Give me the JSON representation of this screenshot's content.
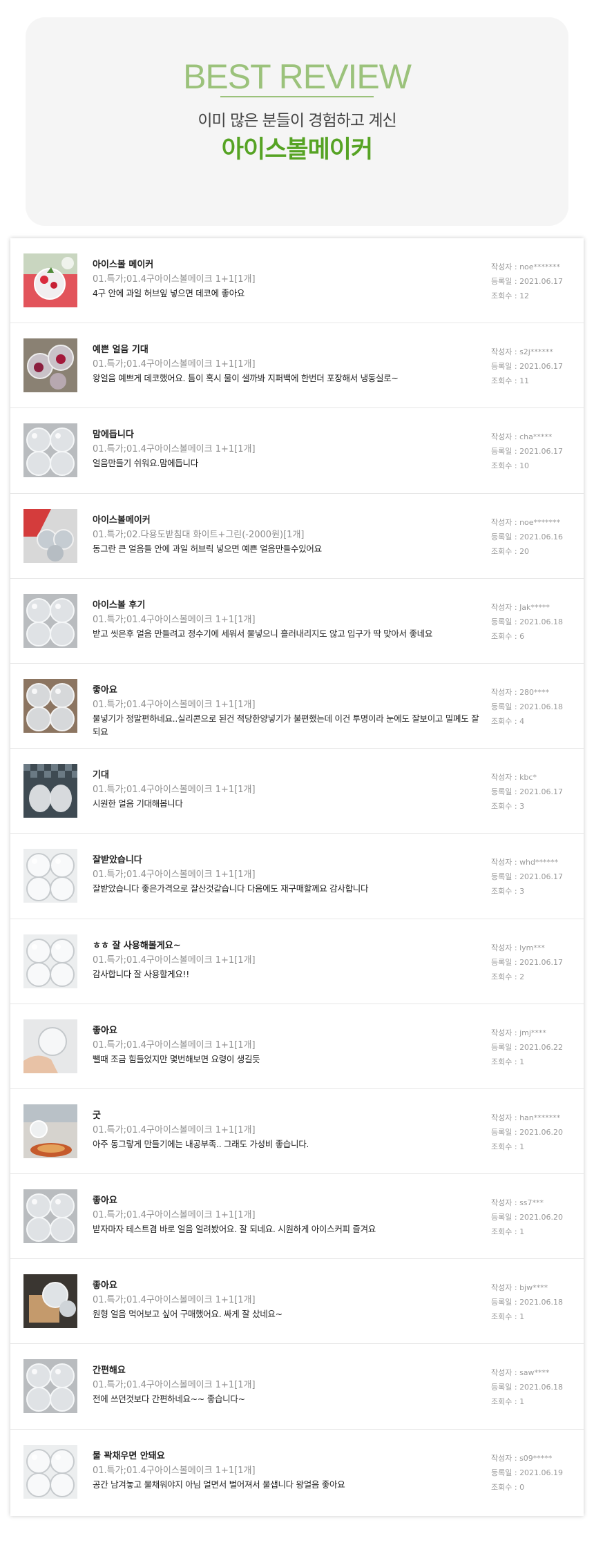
{
  "hero": {
    "title": "BEST REVIEW",
    "subtitle": "이미 많은 분들이 경험하고 계신",
    "product": "아이스볼메이커"
  },
  "labels": {
    "writer": "작성자 : ",
    "date": "등록일 : ",
    "views": "조회수 : "
  },
  "reviews": [
    {
      "title": "아이스볼 메이커",
      "option": "01.특가;01.4구아이스볼메이크 1+1[1개]",
      "text": "4구 안에 과일 허브잎 넣으면 데코에 좋아요",
      "writer": "noe*******",
      "date": "2021.06.17",
      "views": "12",
      "thumb": "strawberry"
    },
    {
      "title": "예쁜 얼음 기대",
      "option": "01.특가;01.4구아이스볼메이크 1+1[1개]",
      "text": "왕얼음 예쁘게 데코했어요. 틈이 혹시 물이 샐까봐 지퍼백에 한번더 포장해서 냉동실로~",
      "writer": "s2j******",
      "date": "2021.06.17",
      "views": "11",
      "thumb": "berries"
    },
    {
      "title": "맘에듭니다",
      "option": "01.특가;01.4구아이스볼메이크 1+1[1개]",
      "text": "얼음만들기 쉬워요.맘에듭니다",
      "writer": "cha*****",
      "date": "2021.06.17",
      "views": "10",
      "thumb": "clear"
    },
    {
      "title": "아이스볼메이커",
      "option": "01.특가;02.다용도받침대 화이트+그린(-2000원)[1개]",
      "text": "동그란 큰 얼음들 안에 과일 허브릭 넣으면 예쁜 얼음만들수있어요",
      "writer": "noe*******",
      "date": "2021.06.16",
      "views": "20",
      "thumb": "redbg"
    },
    {
      "title": "아이스볼 후기",
      "option": "01.특가;01.4구아이스볼메이크 1+1[1개]",
      "text": "받고 씻은후 얼음 만들려고 정수기에 세워서 물넣으니 흘러내리지도 않고 입구가 딱 맞아서 좋네요",
      "writer": "Jak*****",
      "date": "2021.06.18",
      "views": "6",
      "thumb": "clear"
    },
    {
      "title": "좋아요",
      "option": "01.특가;01.4구아이스볼메이크 1+1[1개]",
      "text": "물넣기가 정말편하네요..실리콘으로 된건 적당한양넣기가 불편했는데 이건 투명이라 눈에도 잘보이고 밀폐도 잘되요",
      "writer": "280****",
      "date": "2021.06.18",
      "views": "4",
      "thumb": "wood"
    },
    {
      "title": "기대",
      "option": "01.특가;01.4구아이스볼메이크 1+1[1개]",
      "text": "시원한 얼음 기대해봅니다",
      "writer": "kbc*",
      "date": "2021.06.17",
      "views": "3",
      "thumb": "checker"
    },
    {
      "title": "잘받았습니다",
      "option": "01.특가;01.4구아이스볼메이크 1+1[1개]",
      "text": "잘받았습니다 좋은가격으로 잘산것같습니다 다음에도 재구매할께요 감사합니다",
      "writer": "whd******",
      "date": "2021.06.17",
      "views": "3",
      "thumb": "white"
    },
    {
      "title": "ㅎㅎ 잘 사용해볼게요~",
      "option": "01.특가;01.4구아이스볼메이크 1+1[1개]",
      "text": "감사합니다 잘 사용할게요!!",
      "writer": "lym***",
      "date": "2021.06.17",
      "views": "2",
      "thumb": "white"
    },
    {
      "title": "좋아요",
      "option": "01.특가;01.4구아이스볼메이크 1+1[1개]",
      "text": "뺄때 조금 힘들었지만 몇번해보면 요령이 생길듯",
      "writer": "jmj****",
      "date": "2021.06.22",
      "views": "1",
      "thumb": "hand"
    },
    {
      "title": "굿",
      "option": "01.특가;01.4구아이스볼메이크 1+1[1개]",
      "text": "아주 동그랗게 만들기에는 내공부족.. 그래도 가성비 좋습니다.",
      "writer": "han*******",
      "date": "2021.06.20",
      "views": "1",
      "thumb": "food"
    },
    {
      "title": "좋아요",
      "option": "01.특가;01.4구아이스볼메이크 1+1[1개]",
      "text": "받자마자 테스트겸 바로 얼음 얼려봤어요. 잘 되네요. 시원하게 아이스커피 즐겨요",
      "writer": "ss7***",
      "date": "2021.06.20",
      "views": "1",
      "thumb": "clear"
    },
    {
      "title": "좋아요",
      "option": "01.특가;01.4구아이스볼메이크 1+1[1개]",
      "text": "원형 얼음 먹어보고 싶어 구매했어요. 싸게 잘 샀네요~",
      "writer": "bjw****",
      "date": "2021.06.18",
      "views": "1",
      "thumb": "box"
    },
    {
      "title": "간편해요",
      "option": "01.특가;01.4구아이스볼메이크 1+1[1개]",
      "text": "전에 쓰던것보다 간편하네요~~ 좋습니다~",
      "writer": "saw****",
      "date": "2021.06.18",
      "views": "1",
      "thumb": "clear"
    },
    {
      "title": "물 꽉채우면 안돼요",
      "option": "01.특가;01.4구아이스볼메이크 1+1[1개]",
      "text": "공간 남겨놓고 물채워야지 아님 얼면서 벌어져서 물샙니다 왕얼음 좋아요",
      "writer": "s09*****",
      "date": "2021.06.19",
      "views": "0",
      "thumb": "white"
    }
  ]
}
